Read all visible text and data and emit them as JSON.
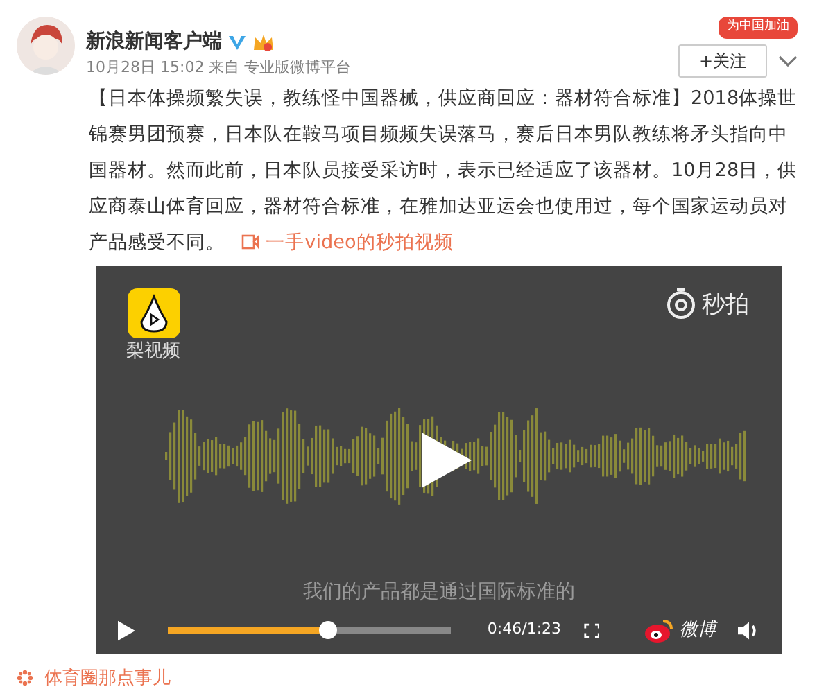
{
  "post": {
    "author": "新浪新闻客户端",
    "verified": true,
    "meta": "10月28日 15:02 来自 专业版微博平台",
    "banner": "为中国加油",
    "follow": "+关注",
    "text": "【日本体操频繁失误，教练怪中国器械，供应商回应：器材符合标准】2018体操世锦赛男团预赛，日本队在鞍马项目频频失误落马，赛后日本男队教练将矛头指向中国器材。然而此前，日本队员接受采访时，表示已经适应了该器材。10月28日，供应商泰山体育回应，器材符合标准，在雅加达亚运会也使用过，每个国家运动员对产品感受不同。",
    "link": "一手video的秒拍视频"
  },
  "video": {
    "channel": "梨视频",
    "watermark": "秒拍",
    "subtitle": "我们的产品都是通过国际标准的",
    "time": "0:46/1:23",
    "level": 0.56,
    "brand": "微博"
  },
  "topic": "体育圈那点事儿"
}
